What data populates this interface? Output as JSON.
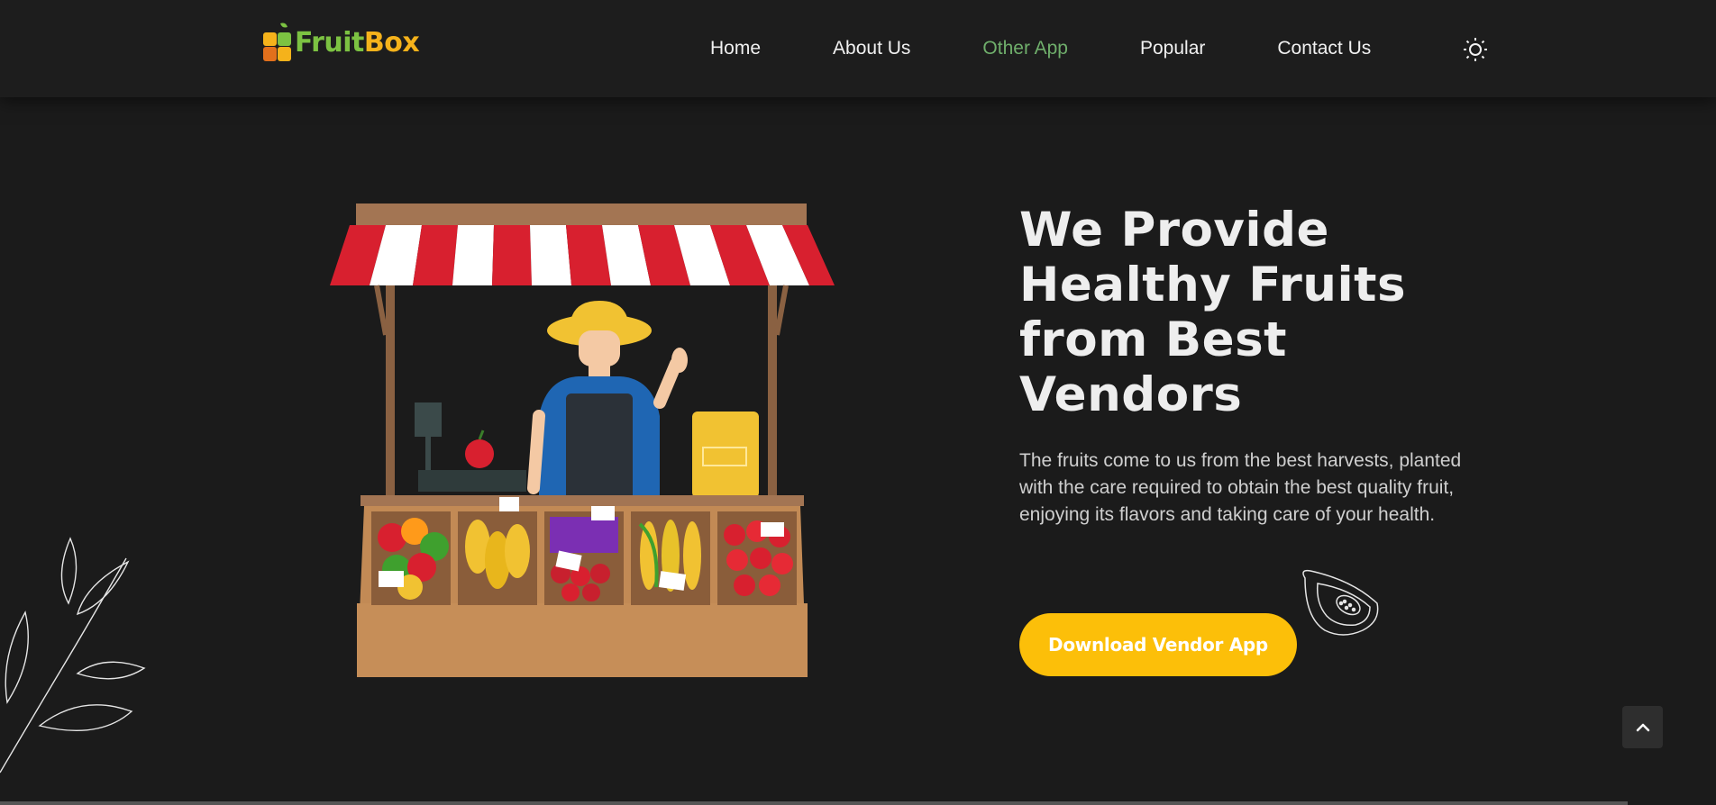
{
  "brand": {
    "name_part1": "Fruit",
    "name_part2": "Box",
    "logo_icon": "fruit-box-logo-icon"
  },
  "nav": {
    "items": [
      {
        "label": "Home",
        "active": false
      },
      {
        "label": "About Us",
        "active": false
      },
      {
        "label": "Other App",
        "active": true
      },
      {
        "label": "Popular",
        "active": false
      },
      {
        "label": "Contact Us",
        "active": false
      }
    ],
    "theme_toggle_icon": "sun-icon"
  },
  "hero": {
    "title": "We Provide Healthy Fruits from Best Vendors",
    "description": "The fruits come to us from the best harvests, planted with the care required to obtain the best quality fruit, enjoying its flavors and taking care of your health.",
    "cta_label": "Download Vendor App",
    "illustration": "fruit-stall-vendor-illustration"
  },
  "scroll_top_icon": "chevron-up-icon",
  "colors": {
    "background": "#1b1b1b",
    "accent_yellow": "#fcbf09",
    "active_nav": "#6fae6b",
    "logo_green": "#7cc242",
    "logo_orange": "#f5b21b"
  }
}
